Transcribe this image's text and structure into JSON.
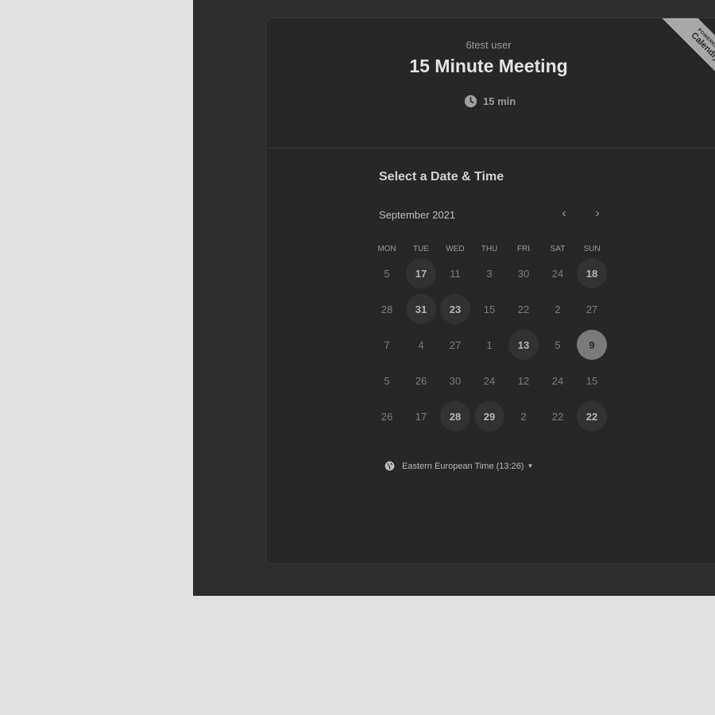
{
  "event": {
    "host": "6test user",
    "title": "15 Minute Meeting",
    "duration": "15 min"
  },
  "ribbon": {
    "line1": "POWERED BY",
    "brand": "Calendly"
  },
  "scheduler": {
    "heading": "Select a Date & Time",
    "month": "September 2021",
    "prev_icon": "chevron-left-icon",
    "next_icon": "chevron-right-icon",
    "weekdays": [
      "MON",
      "TUE",
      "WED",
      "THU",
      "FRI",
      "SAT",
      "SUN"
    ],
    "weeks": [
      [
        {
          "d": "5",
          "s": "off"
        },
        {
          "d": "17",
          "s": "avail"
        },
        {
          "d": "11",
          "s": "off"
        },
        {
          "d": "3",
          "s": "off"
        },
        {
          "d": "30",
          "s": "off"
        },
        {
          "d": "24",
          "s": "off"
        },
        {
          "d": "18",
          "s": "avail"
        }
      ],
      [
        {
          "d": "28",
          "s": "off"
        },
        {
          "d": "31",
          "s": "avail"
        },
        {
          "d": "23",
          "s": "avail"
        },
        {
          "d": "15",
          "s": "off"
        },
        {
          "d": "22",
          "s": "off"
        },
        {
          "d": "2",
          "s": "off"
        },
        {
          "d": "27",
          "s": "off"
        }
      ],
      [
        {
          "d": "7",
          "s": "off"
        },
        {
          "d": "4",
          "s": "off"
        },
        {
          "d": "27",
          "s": "off"
        },
        {
          "d": "1",
          "s": "off"
        },
        {
          "d": "13",
          "s": "avail"
        },
        {
          "d": "5",
          "s": "off"
        },
        {
          "d": "9",
          "s": "selected"
        }
      ],
      [
        {
          "d": "5",
          "s": "off"
        },
        {
          "d": "26",
          "s": "off"
        },
        {
          "d": "30",
          "s": "off"
        },
        {
          "d": "24",
          "s": "off"
        },
        {
          "d": "12",
          "s": "off"
        },
        {
          "d": "24",
          "s": "off"
        },
        {
          "d": "15",
          "s": "off"
        }
      ],
      [
        {
          "d": "26",
          "s": "off"
        },
        {
          "d": "17",
          "s": "off"
        },
        {
          "d": "28",
          "s": "avail"
        },
        {
          "d": "29",
          "s": "avail"
        },
        {
          "d": "2",
          "s": "off"
        },
        {
          "d": "22",
          "s": "off"
        },
        {
          "d": "22",
          "s": "avail"
        }
      ]
    ],
    "timezone": "Eastern European Time (13:26)"
  },
  "colors": {
    "overlay_bg": "#2d2d2d",
    "card_bg": "#272727",
    "page_bg": "#e1e1e1",
    "ribbon_bg": "#a8a8a8"
  }
}
